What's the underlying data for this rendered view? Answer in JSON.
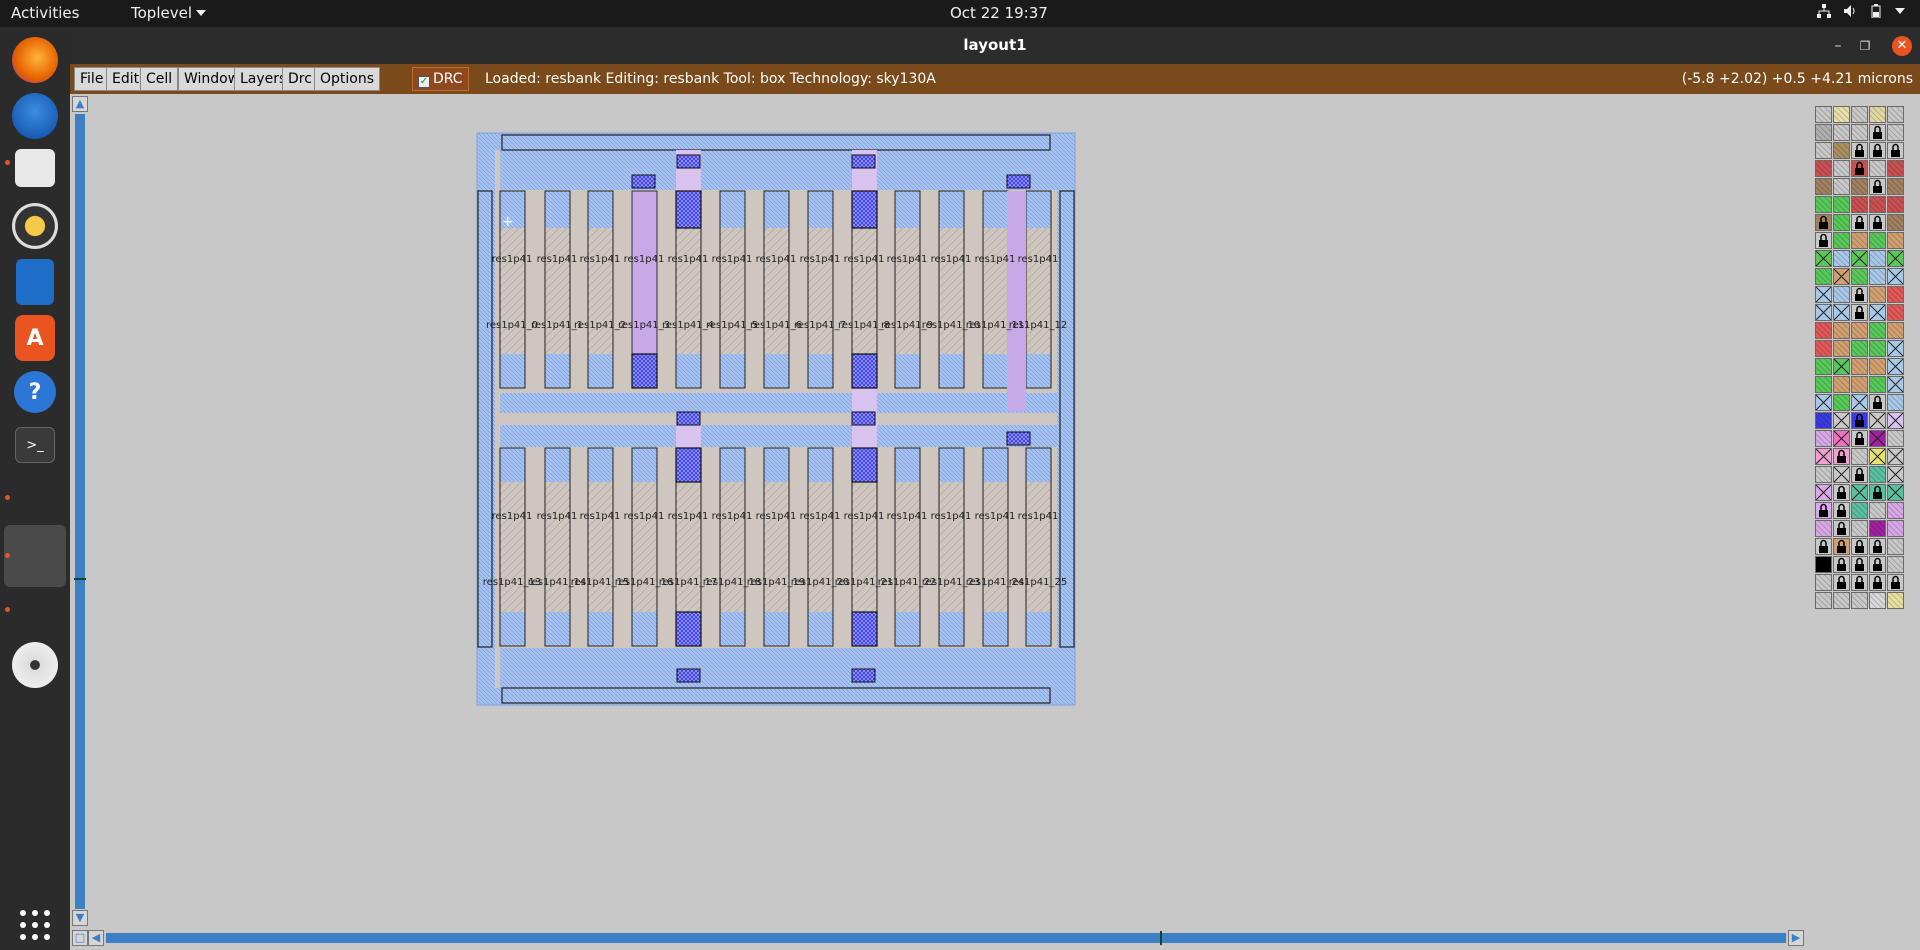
{
  "topbar": {
    "activities": "Activities",
    "app_menu": "Toplevel",
    "clock": "Oct 22  19:37"
  },
  "dock": {
    "icons": [
      "firefox-icon",
      "thunderbird-icon",
      "files-icon",
      "rhythmbox-icon",
      "writer-icon",
      "software-icon",
      "help-icon",
      "terminal-icon",
      "blank-app-icon",
      "dvd-icon",
      "app-grid-icon"
    ]
  },
  "window": {
    "title": "layout1",
    "menus": [
      "File",
      "Edit",
      "Cell",
      "Window",
      "Layers",
      "Drc",
      "Options"
    ],
    "drc_label": "DRC",
    "drc_checked": true,
    "status": "Loaded: resbank Editing: resbank Tool: box  Technology: sky130A",
    "coords": "(-5.8 +2.02) +0.5 +4.21 microns"
  },
  "layout": {
    "cell_prefix": "res1p41",
    "top_names": [
      "res1p41_0",
      "res1p41_1",
      "res1p41_2",
      "res1p41_3",
      "res1p41_4",
      "res1p41_5",
      "res1p41_6",
      "res1p41_7",
      "res1p41_8",
      "res1p41_9",
      "res1p41_10",
      "res1p41_11",
      "res1p41_12"
    ],
    "bottom_names": [
      "res1p41_13",
      "res1p41_14",
      "res1p41_15",
      "res1p41_16",
      "res1p41_17",
      "res1p41_18",
      "res1p41_19",
      "res1p41_20",
      "res1p41_21",
      "res1p41_22",
      "res1p41_23",
      "res1p41_24",
      "res1p41_25"
    ]
  },
  "colors": {
    "accent": "#e95420",
    "menubar": "#7a4a1b",
    "diffusion": "#a9c4f0",
    "contact": "#3a3ae0",
    "poly_res": "#cfc6c0",
    "metal": "#c9a8e8"
  }
}
